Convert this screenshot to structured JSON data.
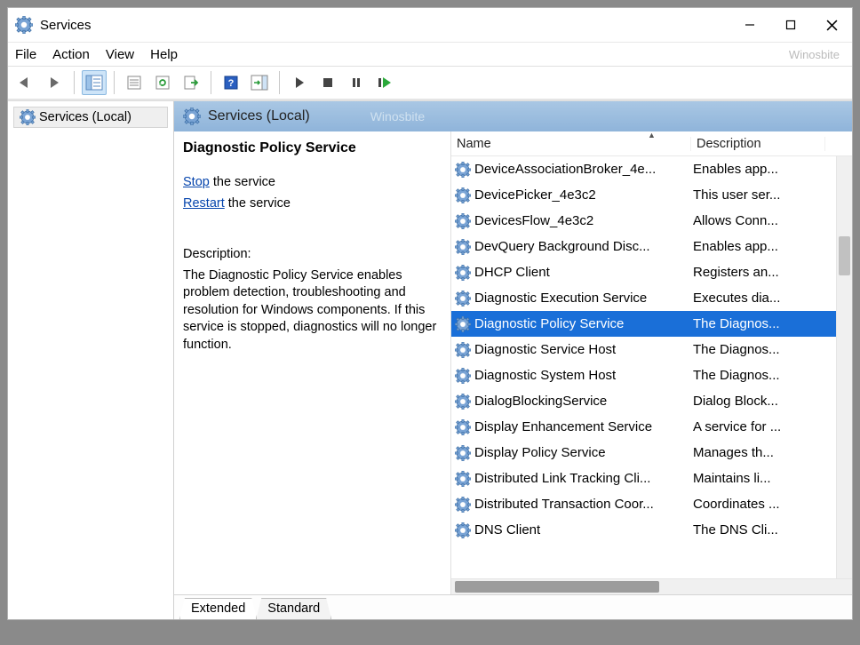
{
  "window": {
    "title": "Services",
    "brand": "Winosbite"
  },
  "menu": {
    "file": "File",
    "action": "Action",
    "view": "View",
    "help": "Help"
  },
  "tree": {
    "root": "Services (Local)"
  },
  "viewheader": {
    "title": "Services (Local)",
    "watermark": "Winosbite"
  },
  "detail": {
    "serviceName": "Diagnostic Policy Service",
    "stop_label": "Stop",
    "stop_suffix": " the service",
    "restart_label": "Restart",
    "restart_suffix": " the service",
    "desc_heading": "Description:",
    "desc_body": "The Diagnostic Policy Service enables problem detection, troubleshooting and resolution for Windows components.  If this service is stopped, diagnostics will no longer function."
  },
  "columns": {
    "name": "Name",
    "description": "Description"
  },
  "services": [
    {
      "name": "DeviceAssociationBroker_4e...",
      "desc": "Enables app..."
    },
    {
      "name": "DevicePicker_4e3c2",
      "desc": "This user ser..."
    },
    {
      "name": "DevicesFlow_4e3c2",
      "desc": "Allows Conn..."
    },
    {
      "name": "DevQuery Background Disc...",
      "desc": "Enables app..."
    },
    {
      "name": "DHCP Client",
      "desc": "Registers an..."
    },
    {
      "name": "Diagnostic Execution Service",
      "desc": "Executes dia..."
    },
    {
      "name": "Diagnostic Policy Service",
      "desc": "The Diagnos...",
      "selected": true
    },
    {
      "name": "Diagnostic Service Host",
      "desc": "The Diagnos..."
    },
    {
      "name": "Diagnostic System Host",
      "desc": "The Diagnos..."
    },
    {
      "name": "DialogBlockingService",
      "desc": "Dialog Block..."
    },
    {
      "name": "Display Enhancement Service",
      "desc": "A service for ..."
    },
    {
      "name": "Display Policy Service",
      "desc": "Manages th..."
    },
    {
      "name": "Distributed Link Tracking Cli...",
      "desc": "Maintains li..."
    },
    {
      "name": "Distributed Transaction Coor...",
      "desc": "Coordinates ..."
    },
    {
      "name": "DNS Client",
      "desc": "The DNS Cli..."
    }
  ],
  "tabs": {
    "extended": "Extended",
    "standard": "Standard"
  }
}
